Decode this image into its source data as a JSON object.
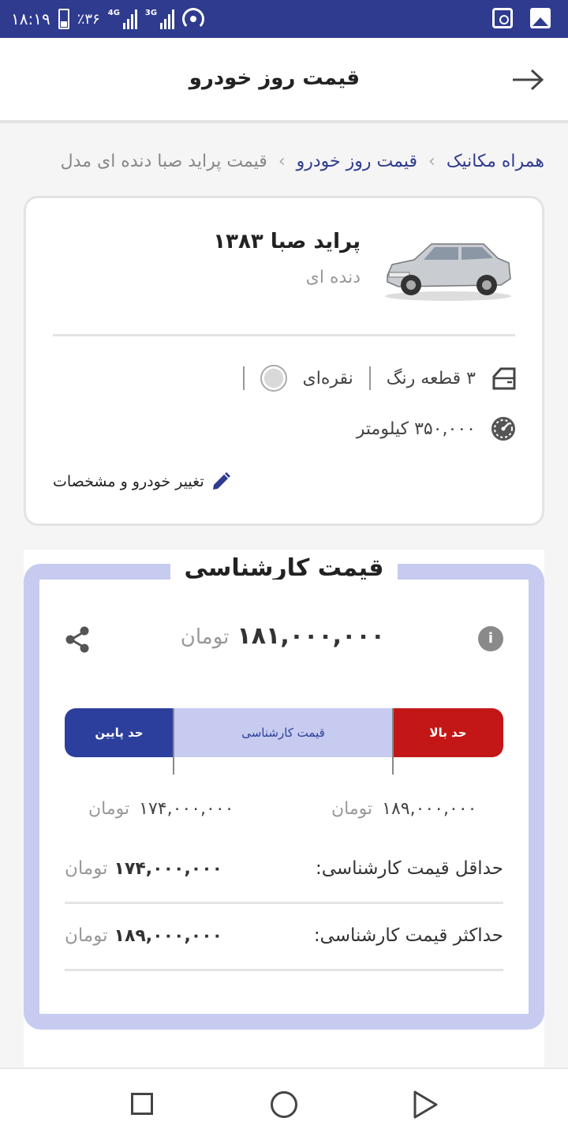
{
  "status_bar": {
    "time": "۱۸:۱۹",
    "battery": "٪۳۶",
    "net1": "4G",
    "net2": "3G"
  },
  "app_bar": {
    "title": "قیمت روز خودرو",
    "back_icon": "arrow-right-icon"
  },
  "breadcrumb": {
    "items": [
      "همراه مکانیک",
      "قیمت روز خودرو"
    ],
    "current": "قیمت پراید صبا دنده ای مدل"
  },
  "car": {
    "title": "پراید صبا ۱۳۸۳",
    "subtitle": "دنده ای",
    "paint": "۳ قطعه رنگ",
    "color": "نقره‌ای",
    "mileage": "۳۵۰,۰۰۰ کیلومتر",
    "edit_label": "تغییر خودرو و مشخصات"
  },
  "price": {
    "title": "قیمت کارشناسی",
    "value": "۱۸۱,۰۰۰,۰۰۰",
    "unit": "تومان",
    "bar": {
      "low_label": "حد پایین",
      "mid_label": "قیمت کارشناسی",
      "high_label": "حد بالا"
    },
    "range_low": "۱۷۴,۰۰۰,۰۰۰",
    "range_high": "۱۸۹,۰۰۰,۰۰۰",
    "min_label": "حداقل قیمت کارشناسی:",
    "min_value": "۱۷۴,۰۰۰,۰۰۰",
    "max_label": "حداکثر قیمت کارشناسی:",
    "max_value": "۱۸۹,۰۰۰,۰۰۰"
  },
  "colors": {
    "brand": "#2f3b8f",
    "low": "#2d3f9c",
    "high": "#c31717",
    "mid": "#c6cbef"
  }
}
